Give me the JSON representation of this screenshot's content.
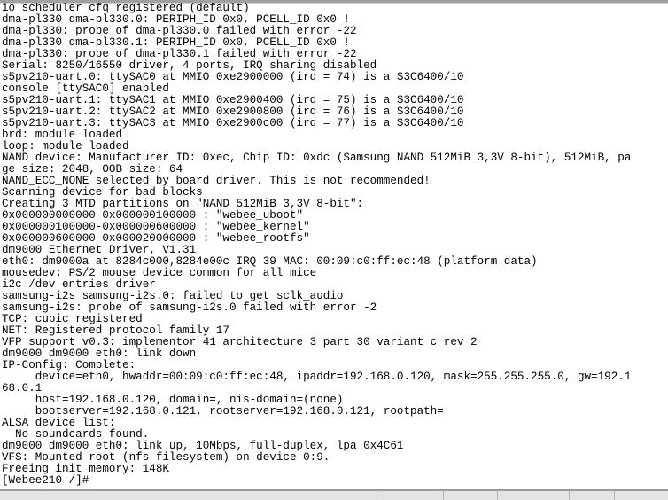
{
  "terminal": {
    "lines": [
      "io scheduler cfq registered (default)",
      "dma-pl330 dma-pl330.0: PERIPH_ID 0x0, PCELL_ID 0x0 !",
      "dma-pl330: probe of dma-pl330.0 failed with error -22",
      "dma-pl330 dma-pl330.1: PERIPH_ID 0x0, PCELL_ID 0x0 !",
      "dma-pl330: probe of dma-pl330.1 failed with error -22",
      "Serial: 8250/16550 driver, 4 ports, IRQ sharing disabled",
      "s5pv210-uart.0: ttySAC0 at MMIO 0xe2900000 (irq = 74) is a S3C6400/10",
      "console [ttySAC0] enabled",
      "s5pv210-uart.1: ttySAC1 at MMIO 0xe2900400 (irq = 75) is a S3C6400/10",
      "s5pv210-uart.2: ttySAC2 at MMIO 0xe2900800 (irq = 76) is a S3C6400/10",
      "s5pv210-uart.3: ttySAC3 at MMIO 0xe2900c00 (irq = 77) is a S3C6400/10",
      "brd: module loaded",
      "loop: module loaded",
      "NAND device: Manufacturer ID: 0xec, Chip ID: 0xdc (Samsung NAND 512MiB 3,3V 8-bit), 512MiB, pa",
      "ge size: 2048, OOB size: 64",
      "NAND_ECC_NONE selected by board driver. This is not recommended!",
      "Scanning device for bad blocks",
      "Creating 3 MTD partitions on \"NAND 512MiB 3,3V 8-bit\":",
      "0x000000000000-0x000000100000 : \"webee_uboot\"",
      "0x000000100000-0x000000600000 : \"webee_kernel\"",
      "0x000000600000-0x000020000000 : \"webee_rootfs\"",
      "dm9000 Ethernet Driver, V1.31",
      "eth0: dm9000a at 8284c000,8284e00c IRQ 39 MAC: 00:09:c0:ff:ec:48 (platform data)",
      "mousedev: PS/2 mouse device common for all mice",
      "i2c /dev entries driver",
      "samsung-i2s samsung-i2s.0: failed to get sclk_audio",
      "samsung-i2s: probe of samsung-i2s.0 failed with error -2",
      "TCP: cubic registered",
      "NET: Registered protocol family 17",
      "VFP support v0.3: implementor 41 architecture 3 part 30 variant c rev 2",
      "dm9000 dm9000 eth0: link down",
      "IP-Config: Complete:",
      "     device=eth0, hwaddr=00:09:c0:ff:ec:48, ipaddr=192.168.0.120, mask=255.255.255.0, gw=192.1",
      "68.0.1",
      "     host=192.168.0.120, domain=, nis-domain=(none)",
      "     bootserver=192.168.0.121, rootserver=192.168.0.121, rootpath=",
      "ALSA device list:",
      "  No soundcards found.",
      "dm9000 dm9000 eth0: link up, 10Mbps, full-duplex, lpa 0x4C61",
      "VFS: Mounted root (nfs filesystem) on device 0:9.",
      "Freeing init memory: 148K",
      "[Webee210 /]#"
    ]
  }
}
